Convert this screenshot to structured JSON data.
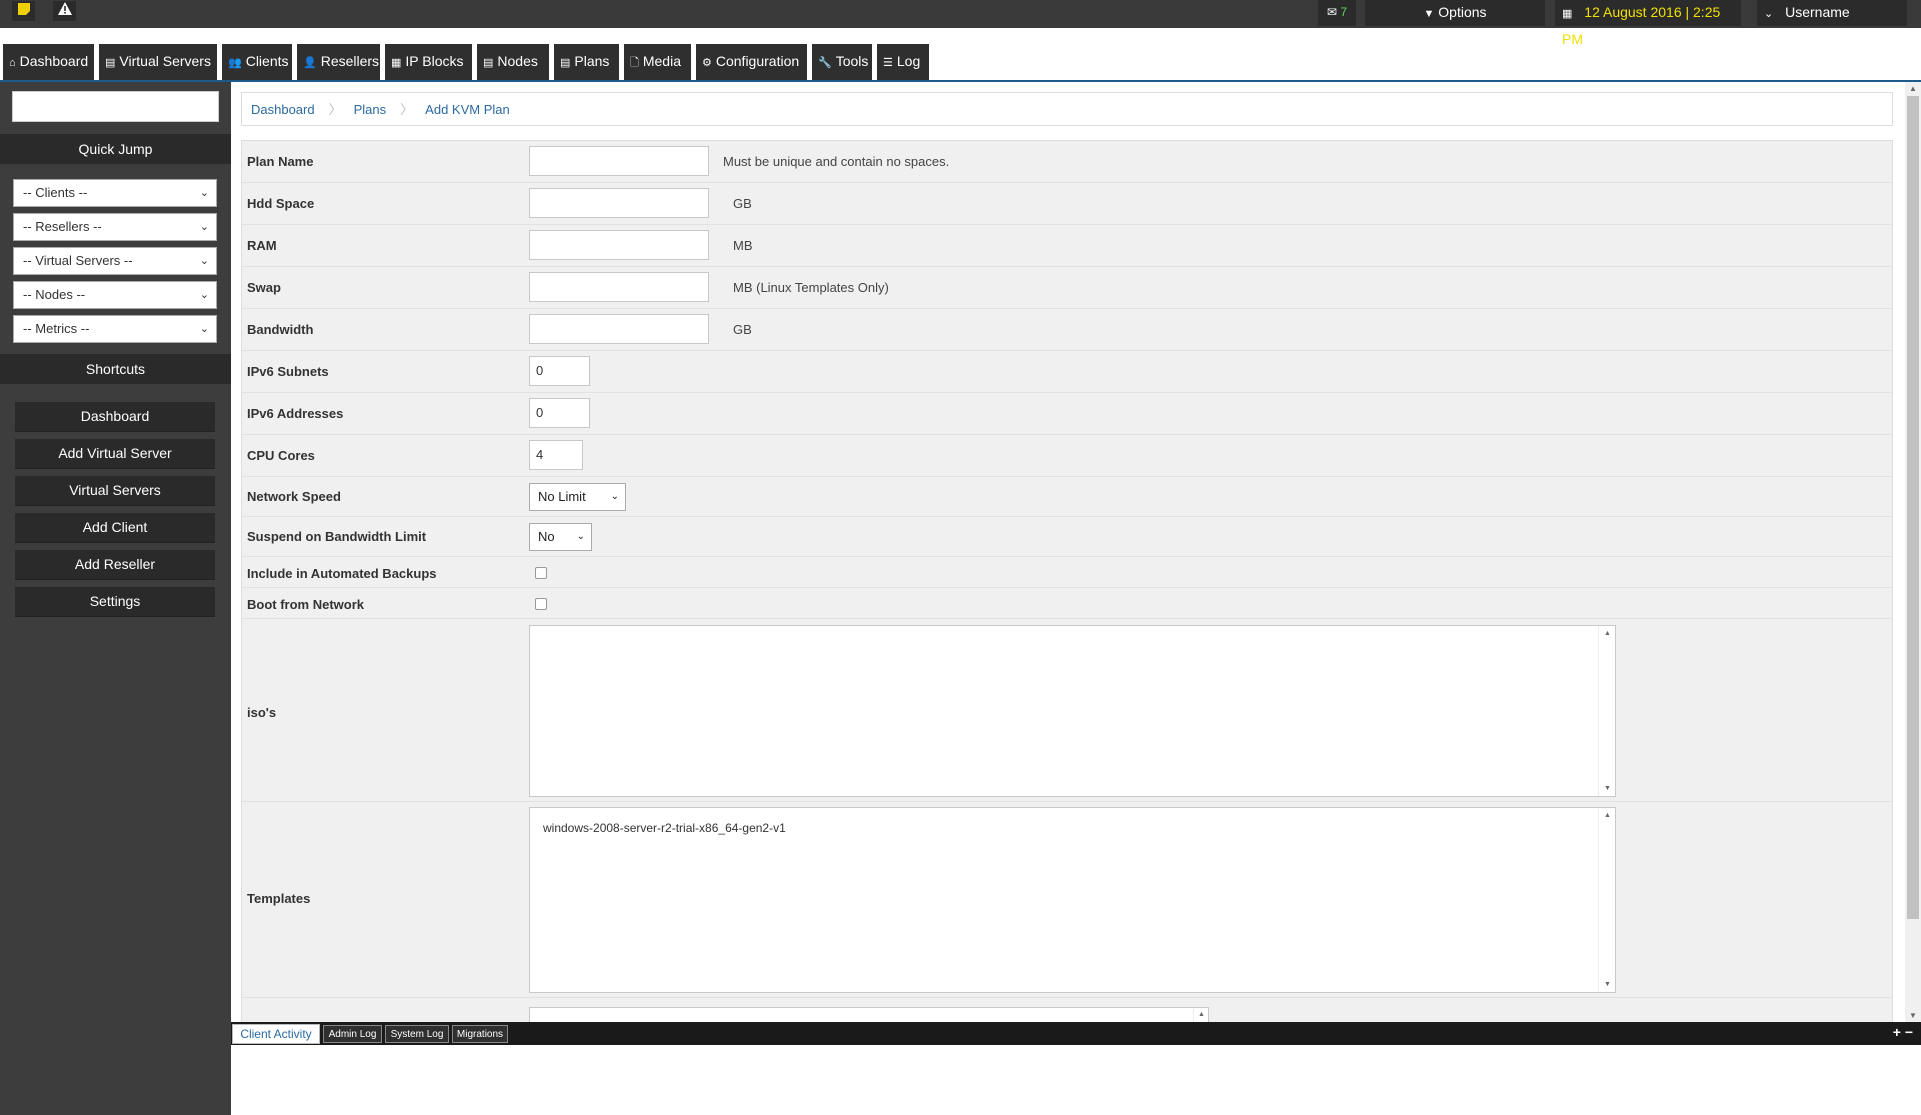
{
  "topbar": {
    "notes_icon": "sticky-note-icon",
    "alert_icon": "warning-icon",
    "mail_count": "7",
    "options_label": "Options",
    "datetime": "12 August 2016 | 2:25 PM",
    "username": "Username"
  },
  "nav": {
    "tabs": [
      {
        "icon": "⌂",
        "label": "Dashboard"
      },
      {
        "icon": "▤",
        "label": "Virtual Servers"
      },
      {
        "icon": "👥",
        "label": "Clients"
      },
      {
        "icon": "👤",
        "label": "Resellers"
      },
      {
        "icon": "▦",
        "label": "IP Blocks"
      },
      {
        "icon": "▤",
        "label": "Nodes"
      },
      {
        "icon": "▤",
        "label": "Plans"
      },
      {
        "icon": "🗋",
        "label": "Media"
      },
      {
        "icon": "⚙",
        "label": "Configuration"
      },
      {
        "icon": "🔧",
        "label": "Tools"
      },
      {
        "icon": "☰",
        "label": "Log"
      }
    ]
  },
  "sidebar": {
    "search_value": "",
    "quick_jump_title": "Quick Jump",
    "selects": [
      "-- Clients --",
      "-- Resellers --",
      "-- Virtual Servers --",
      "-- Nodes --",
      "-- Metrics --"
    ],
    "shortcuts_title": "Shortcuts",
    "shortcuts": [
      "Dashboard",
      "Add Virtual Server",
      "Virtual Servers",
      "Add Client",
      "Add Reseller",
      "Settings"
    ]
  },
  "breadcrumb": [
    "Dashboard",
    "Plans",
    "Add KVM Plan"
  ],
  "form": {
    "plan_name": {
      "label": "Plan Name",
      "value": "",
      "hint": "Must be unique and contain no spaces."
    },
    "hdd_space": {
      "label": "Hdd Space",
      "value": "",
      "hint": "GB"
    },
    "ram": {
      "label": "RAM",
      "value": "",
      "hint": "MB"
    },
    "swap": {
      "label": "Swap",
      "value": "",
      "hint": "MB (Linux Templates Only)"
    },
    "bandwidth": {
      "label": "Bandwidth",
      "value": "",
      "hint": "GB"
    },
    "ipv6_subnets": {
      "label": "IPv6 Subnets",
      "value": "0"
    },
    "ipv6_addresses": {
      "label": "IPv6 Addresses",
      "value": "0"
    },
    "cpu_cores": {
      "label": "CPU Cores",
      "value": "4"
    },
    "network_speed": {
      "label": "Network Speed",
      "value": "No Limit"
    },
    "suspend_bw": {
      "label": "Suspend on Bandwidth Limit",
      "value": "No"
    },
    "auto_backups": {
      "label": "Include in Automated Backups",
      "checked": false
    },
    "boot_network": {
      "label": "Boot from Network",
      "checked": false
    },
    "isos": {
      "label": "iso's",
      "options": []
    },
    "templates": {
      "label": "Templates",
      "options": [
        "windows-2008-server-r2-trial-x86_64-gen2-v1"
      ]
    }
  },
  "logpanel": {
    "tabs": [
      "Client Activity",
      "Admin Log",
      "System Log",
      "Migrations"
    ],
    "active": "Client Activity",
    "controls": "+ −"
  }
}
